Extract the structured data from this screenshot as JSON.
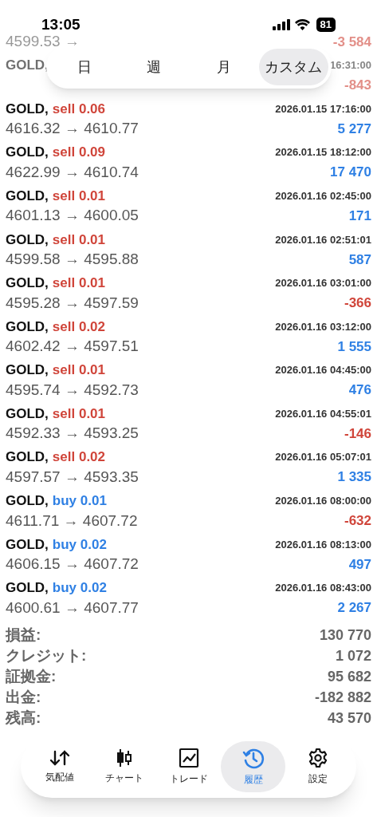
{
  "status_bar": {
    "time": "13:05",
    "battery": "81"
  },
  "period_tabs": [
    {
      "label": "日",
      "selected": false
    },
    {
      "label": "週",
      "selected": false
    },
    {
      "label": "月",
      "selected": false
    },
    {
      "label": "カスタム",
      "selected": true
    }
  ],
  "trades": [
    {
      "dimmed": true,
      "prices": "4599.53 →",
      "profit": "-3 584"
    },
    {
      "dimmed": true,
      "symbol": "GOLD,",
      "time": "16:31:00",
      "profit": "-843"
    },
    {
      "dimmed": false,
      "symbol": "GOLD,",
      "side": "sell",
      "volume": "0.06",
      "time": "2026.01.15 17:16:00",
      "prices": "4616.32 → 4610.77",
      "profit": "5 277"
    },
    {
      "dimmed": false,
      "symbol": "GOLD,",
      "side": "sell",
      "volume": "0.09",
      "time": "2026.01.15 18:12:00",
      "prices": "4622.99 → 4610.74",
      "profit": "17 470"
    },
    {
      "dimmed": false,
      "symbol": "GOLD,",
      "side": "sell",
      "volume": "0.01",
      "time": "2026.01.16 02:45:00",
      "prices": "4601.13 → 4600.05",
      "profit": "171"
    },
    {
      "dimmed": false,
      "symbol": "GOLD,",
      "side": "sell",
      "volume": "0.01",
      "time": "2026.01.16 02:51:01",
      "prices": "4599.58 → 4595.88",
      "profit": "587"
    },
    {
      "dimmed": false,
      "symbol": "GOLD,",
      "side": "sell",
      "volume": "0.01",
      "time": "2026.01.16 03:01:00",
      "prices": "4595.28 → 4597.59",
      "profit": "-366"
    },
    {
      "dimmed": false,
      "symbol": "GOLD,",
      "side": "sell",
      "volume": "0.02",
      "time": "2026.01.16 03:12:00",
      "prices": "4602.42 → 4597.51",
      "profit": "1 555"
    },
    {
      "dimmed": false,
      "symbol": "GOLD,",
      "side": "sell",
      "volume": "0.01",
      "time": "2026.01.16 04:45:00",
      "prices": "4595.74 → 4592.73",
      "profit": "476"
    },
    {
      "dimmed": false,
      "symbol": "GOLD,",
      "side": "sell",
      "volume": "0.01",
      "time": "2026.01.16 04:55:01",
      "prices": "4592.33 → 4593.25",
      "profit": "-146"
    },
    {
      "dimmed": false,
      "symbol": "GOLD,",
      "side": "sell",
      "volume": "0.02",
      "time": "2026.01.16 05:07:01",
      "prices": "4597.57 → 4593.35",
      "profit": "1 335"
    },
    {
      "dimmed": false,
      "symbol": "GOLD,",
      "side": "buy",
      "volume": "0.01",
      "time": "2026.01.16 08:00:00",
      "prices": "4611.71 → 4607.72",
      "profit": "-632"
    },
    {
      "dimmed": false,
      "symbol": "GOLD,",
      "side": "buy",
      "volume": "0.02",
      "time": "2026.01.16 08:13:00",
      "prices": "4606.15 → 4607.72",
      "profit": "497"
    },
    {
      "dimmed": false,
      "symbol": "GOLD,",
      "side": "buy",
      "volume": "0.02",
      "time": "2026.01.16 08:43:00",
      "prices": "4600.61 → 4607.77",
      "profit": "2 267"
    }
  ],
  "summary": [
    {
      "label": "損益:",
      "value": "130 770"
    },
    {
      "label": "クレジット:",
      "value": "1 072"
    },
    {
      "label": "証拠金:",
      "value": "95 682"
    },
    {
      "label": "出金:",
      "value": "-182 882"
    },
    {
      "label": "残高:",
      "value": "43 570"
    }
  ],
  "tab_bar": [
    {
      "kind": "quotes",
      "label": "気配値",
      "selected": false
    },
    {
      "kind": "chart",
      "label": "チャート",
      "selected": false
    },
    {
      "kind": "trade",
      "label": "トレード",
      "selected": false
    },
    {
      "kind": "history",
      "label": "履歴",
      "selected": true
    },
    {
      "kind": "settings",
      "label": "設定",
      "selected": false
    }
  ]
}
